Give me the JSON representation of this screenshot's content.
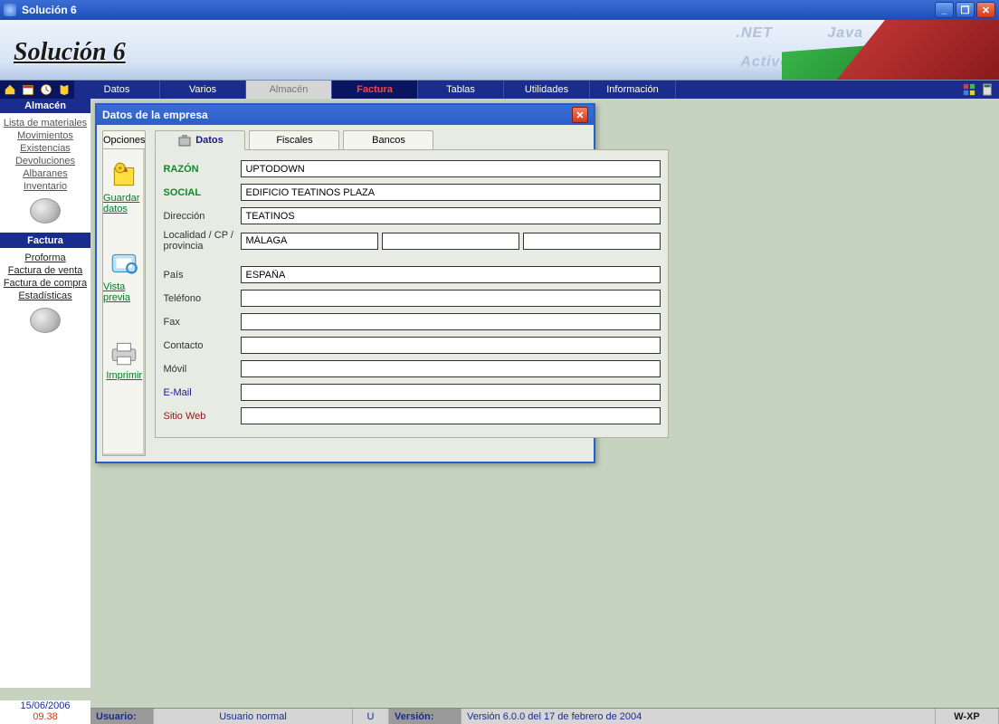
{
  "window": {
    "title": "Solución 6"
  },
  "banner": {
    "title": "Solución 6",
    "ghost1": ".NET",
    "ghost2": "Java",
    "ghost3": "ActiveX"
  },
  "menu": {
    "items": [
      "Datos",
      "Varios",
      "Almacén",
      "Factura",
      "Tablas",
      "Utilidades",
      "Información"
    ]
  },
  "sidebar": {
    "section1": {
      "title": "Almacén",
      "links": [
        "Lista de materiales",
        "Movimientos",
        "Existencias",
        "Devoluciones",
        "Albaranes",
        "Inventario"
      ]
    },
    "section2": {
      "title": "Factura",
      "links": [
        "Proforma",
        "Factura de venta",
        "Factura de compra",
        "Estadísticas"
      ]
    }
  },
  "dialog": {
    "title": "Datos de la empresa",
    "opt_tab": "Opciones",
    "actions": {
      "save": "Guardar datos",
      "preview": "Vista previa",
      "print": "Imprimir"
    },
    "tabs": [
      "Datos",
      "Fiscales",
      "Bancos"
    ],
    "fields": {
      "razon_label": "RAZÓN",
      "razon_value": "UPTODOWN",
      "social_label": "SOCIAL",
      "social_value": "EDIFICIO TEATINOS PLAZA",
      "direccion_label": "Dirección",
      "direccion_value": "TEATINOS",
      "localidad_label": "Localidad / CP / provincia",
      "localidad_value": "MÁLAGA",
      "cp_value": "",
      "provincia_value": "",
      "pais_label": "País",
      "pais_value": "ESPAÑA",
      "telefono_label": "Teléfono",
      "telefono_value": "",
      "fax_label": "Fax",
      "fax_value": "",
      "contacto_label": "Contacto",
      "contacto_value": "",
      "movil_label": "Móvil",
      "movil_value": "",
      "email_label": "E-Mail",
      "email_value": "",
      "sitio_label": "Sitio Web",
      "sitio_value": ""
    }
  },
  "status": {
    "usuario_label": "Usuario:",
    "usuario_value": "Usuario normal",
    "u": "U",
    "version_label": "Versión:",
    "version_value": "Versión 6.0.0 del 17 de febrero de 2004",
    "os": "W-XP"
  },
  "footer": {
    "date": "15/06/2006",
    "time": "09.38"
  }
}
